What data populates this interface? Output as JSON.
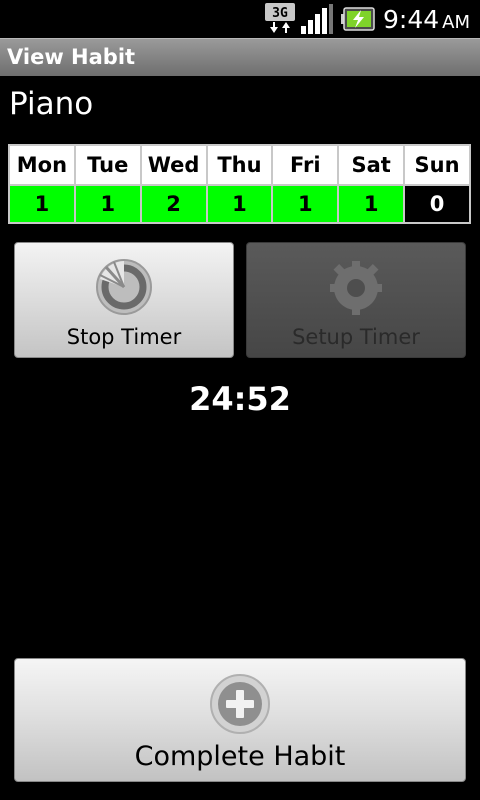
{
  "status_bar": {
    "network_label": "3G",
    "time": "9:44",
    "ampm": "AM"
  },
  "title_bar": {
    "title": "View Habit"
  },
  "habit": {
    "name": "Piano"
  },
  "week": {
    "days": [
      "Mon",
      "Tue",
      "Wed",
      "Thu",
      "Fri",
      "Sat",
      "Sun"
    ],
    "counts": [
      "1",
      "1",
      "2",
      "1",
      "1",
      "1",
      "0"
    ]
  },
  "buttons": {
    "stop_timer": "Stop Timer",
    "setup_timer": "Setup Timer",
    "complete_habit": "Complete Habit"
  },
  "timer": {
    "value": "24:52"
  },
  "colors": {
    "done": "#00ff00",
    "none": "#000000"
  }
}
